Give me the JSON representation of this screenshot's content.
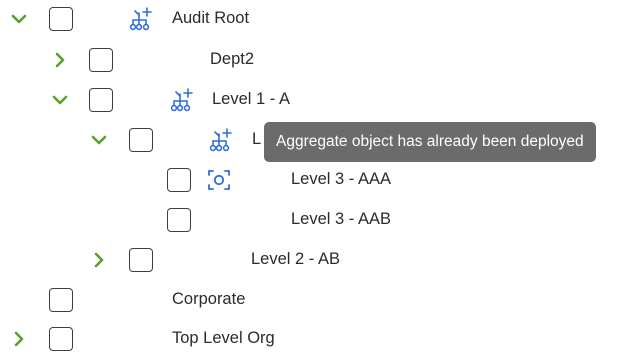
{
  "tree": {
    "nodes": [
      {
        "label": "Audit Root",
        "expanded": true,
        "icon": "aggregate-hierarchy-icon"
      },
      {
        "label": "Dept2",
        "expanded": false
      },
      {
        "label": "Level 1 - A",
        "expanded": true,
        "icon": "aggregate-hierarchy-icon"
      },
      {
        "label": "L",
        "expanded": true,
        "icon": "aggregate-hierarchy-icon"
      },
      {
        "label": "Level 3 - AAA",
        "icon": "focus-target-icon"
      },
      {
        "label": "Level 3 - AAB"
      },
      {
        "label": "Level 2 - AB",
        "expanded": false
      },
      {
        "label": "Corporate"
      },
      {
        "label": "Top Level Org",
        "expanded": false
      }
    ]
  },
  "tooltip": {
    "text": "Aggregate object has already been deployed"
  },
  "colors": {
    "chevron": "#5aa02c",
    "icon": "#2f6fd6",
    "text": "#2b2b2b",
    "checkbox_border": "#3d3d3d",
    "tooltip_bg": "#6b6b6b",
    "tooltip_text": "#ffffff"
  }
}
